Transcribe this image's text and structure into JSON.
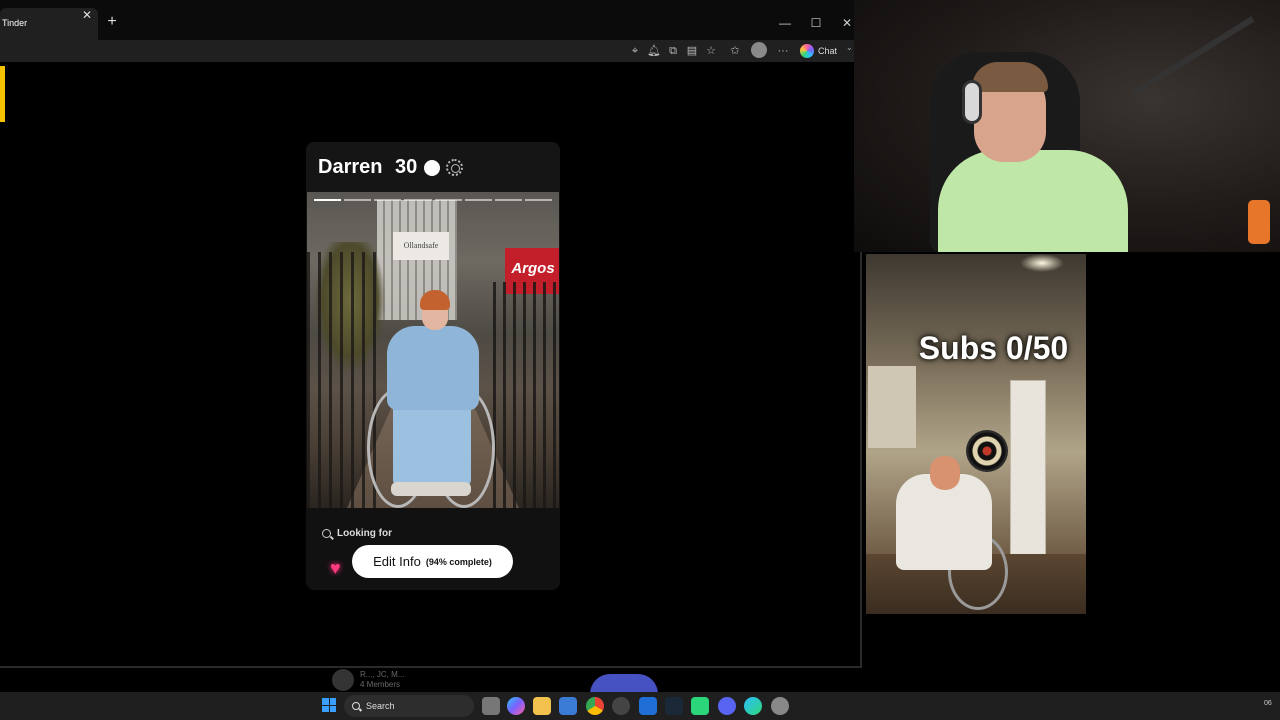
{
  "browser": {
    "tab_title": "Tinder",
    "tab_close": "✕",
    "new_tab": "+",
    "window": {
      "minimize": "—",
      "maximize": "☐",
      "close": "✕"
    },
    "toolbar": {
      "chat_label": "Chat"
    }
  },
  "profile": {
    "name": "Darren",
    "age": "30",
    "photo_count": 8,
    "active_photo": 0,
    "photo_sign": "Ollandsafe",
    "photo_store": "Argos",
    "looking_for_label": "Looking for",
    "edit_label": "Edit Info",
    "edit_progress": "(94% complete)"
  },
  "overlay": {
    "subs_text": "Subs 0/50"
  },
  "voice": {
    "names": "R..., JC, M...",
    "members": "4 Members"
  },
  "taskbar": {
    "search_placeholder": "Search",
    "clock": "06"
  },
  "colors": {
    "accent_yellow": "#f5c200",
    "heart_pink": "#ff3a7a",
    "start_blue": "#3aa0ff"
  },
  "icons": [
    "close-icon",
    "plus-icon",
    "location-icon",
    "bell-icon",
    "extensions-icon",
    "reader-icon",
    "favorite-icon",
    "collections-icon",
    "profile-avatar",
    "more-icon",
    "copilot-icon",
    "verified-icon",
    "search-icon",
    "heart-arrow-icon",
    "windows-start-icon"
  ]
}
